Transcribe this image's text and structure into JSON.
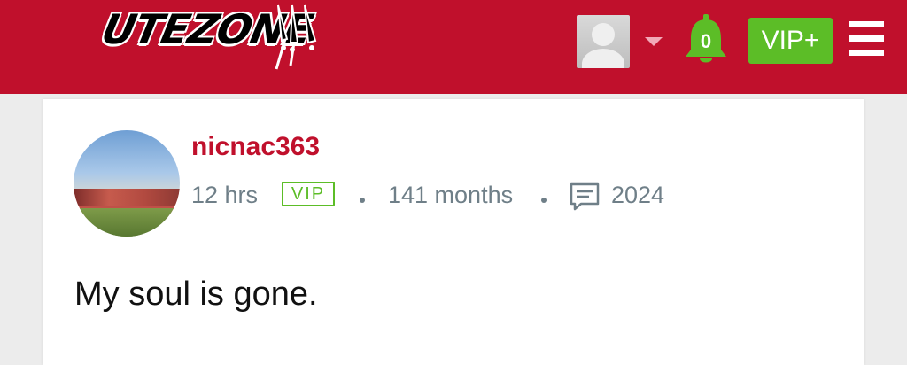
{
  "header": {
    "logo_text": "UTEZONE",
    "notification_count": "0",
    "vip_button_label": "VIP+",
    "icons": [
      "user-avatar",
      "caret-down-icon",
      "bell-icon",
      "hamburger-menu-icon"
    ],
    "colors": {
      "brand": "#c0102c",
      "vip_green": "#5cbd27"
    }
  },
  "post": {
    "author": "nicnac363",
    "time": "12 hrs",
    "badge": "VIP",
    "membership": "141 months",
    "post_count": "2024",
    "body": "My soul is gone."
  }
}
